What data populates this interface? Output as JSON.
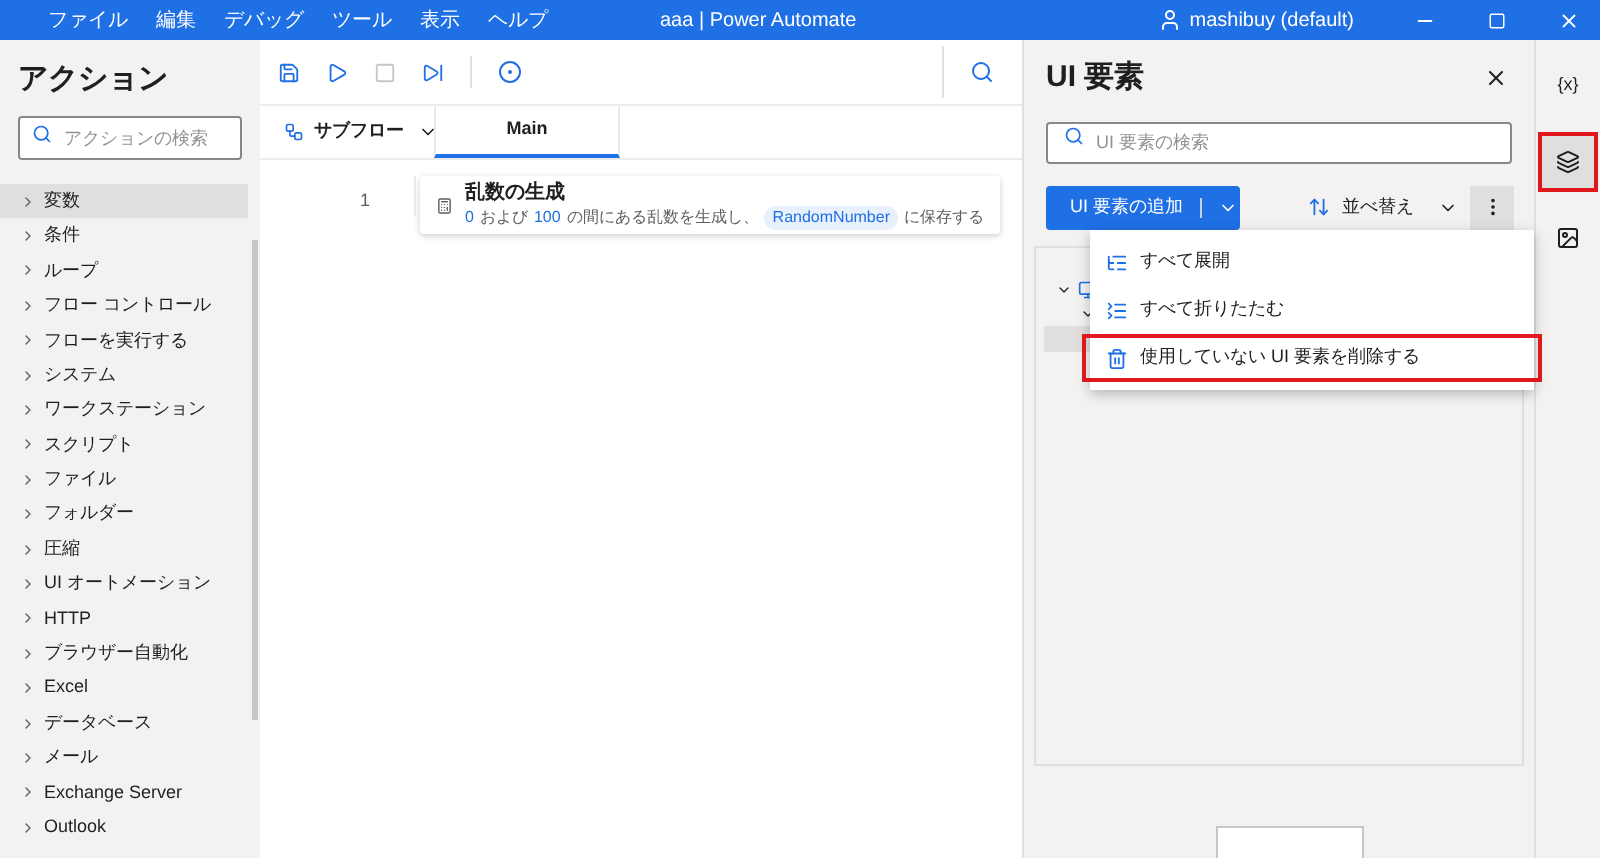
{
  "window": {
    "title": "aaa | Power Automate",
    "user": "mashibuy (default)"
  },
  "menu": [
    "ファイル",
    "編集",
    "デバッグ",
    "ツール",
    "表示",
    "ヘルプ"
  ],
  "actions": {
    "title": "アクション",
    "search": {
      "placeholder": "アクションの検索"
    },
    "items": [
      {
        "label": "変数",
        "selected": true
      },
      {
        "label": "条件",
        "selected": false
      },
      {
        "label": "ループ",
        "selected": false
      },
      {
        "label": "フロー コントロール",
        "selected": false
      },
      {
        "label": "フローを実行する",
        "selected": false
      },
      {
        "label": "システム",
        "selected": false
      },
      {
        "label": "ワークステーション",
        "selected": false
      },
      {
        "label": "スクリプト",
        "selected": false
      },
      {
        "label": "ファイル",
        "selected": false
      },
      {
        "label": "フォルダー",
        "selected": false
      },
      {
        "label": "圧縮",
        "selected": false
      },
      {
        "label": "UI オートメーション",
        "selected": false
      },
      {
        "label": "HTTP",
        "selected": false
      },
      {
        "label": "ブラウザー自動化",
        "selected": false
      },
      {
        "label": "Excel",
        "selected": false
      },
      {
        "label": "データベース",
        "selected": false
      },
      {
        "label": "メール",
        "selected": false
      },
      {
        "label": "Exchange Server",
        "selected": false
      },
      {
        "label": "Outlook",
        "selected": false
      }
    ]
  },
  "flow": {
    "subflow_button": "サブフロー",
    "tabs": [
      {
        "label": "Main",
        "selected": true
      }
    ],
    "steps": [
      {
        "number": "1",
        "title": "乱数の生成",
        "parts": [
          {
            "kind": "value",
            "text": "0"
          },
          {
            "kind": "text",
            "text": "および"
          },
          {
            "kind": "value",
            "text": "100"
          },
          {
            "kind": "text",
            "text": "の間にある乱数を生成し、"
          },
          {
            "kind": "variable",
            "text": "RandomNumber"
          },
          {
            "kind": "text",
            "text": "に保存する"
          }
        ]
      }
    ]
  },
  "ui_elements": {
    "title": "UI 要素",
    "search": {
      "placeholder": "UI 要素の検索"
    },
    "add_button": "UI 要素の追加",
    "sort_button": "並べ替え",
    "menu_items": [
      {
        "label": "すべて展開",
        "highlighted": false
      },
      {
        "label": "すべて折りたたむ",
        "highlighted": false
      },
      {
        "label": "使用していない UI 要素を削除する",
        "highlighted": true
      }
    ]
  },
  "rail": [
    {
      "kind": "variables",
      "label": "{x}",
      "highlighted": false
    },
    {
      "kind": "ui-elements",
      "highlighted": true
    },
    {
      "kind": "images",
      "highlighted": false
    }
  ]
}
